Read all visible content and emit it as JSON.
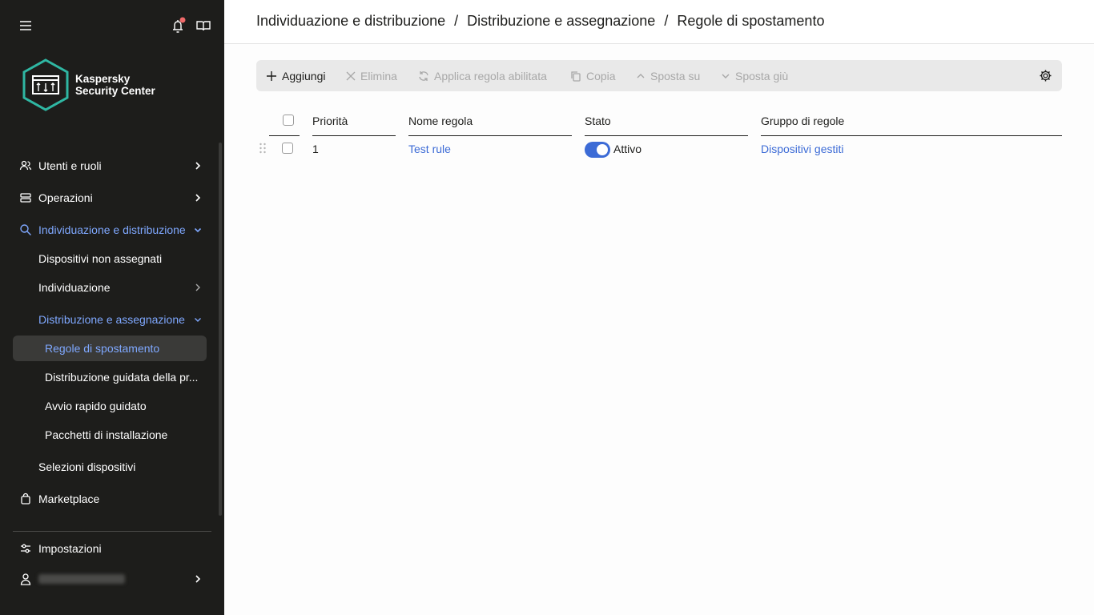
{
  "brand": {
    "line1": "Kaspersky",
    "line2": "Security Center"
  },
  "breadcrumb": [
    "Individuazione e distribuzione",
    "Distribuzione e assegnazione",
    "Regole di spostamento"
  ],
  "breadcrumb_sep": "/",
  "sidebar": {
    "items": [
      {
        "label": "Utenti e ruoli",
        "icon": "users-icon",
        "chevron": "right"
      },
      {
        "label": "Operazioni",
        "icon": "server-icon",
        "chevron": "right"
      },
      {
        "label": "Individuazione e distribuzione",
        "icon": "search-icon",
        "chevron": "down",
        "active": true
      },
      {
        "label": "Dispositivi non assegnati"
      },
      {
        "label": "Individuazione",
        "chevron": "right"
      },
      {
        "label": "Distribuzione e assegnazione",
        "chevron": "down",
        "active": true
      },
      {
        "label": "Regole di spostamento",
        "selected": true
      },
      {
        "label": "Distribuzione guidata della pr..."
      },
      {
        "label": "Avvio rapido guidato"
      },
      {
        "label": "Pacchetti di installazione"
      },
      {
        "label": "Selezioni dispositivi"
      },
      {
        "label": "Marketplace",
        "icon": "bag-icon"
      }
    ],
    "bottom": [
      {
        "label": "Impostazioni",
        "icon": "sliders-icon"
      },
      {
        "label": "",
        "icon": "user-icon",
        "chevron": "right"
      }
    ],
    "accent": "#7fa8ff"
  },
  "toolbar": {
    "add": "Aggiungi",
    "delete": "Elimina",
    "apply": "Applica regola abilitata",
    "copy": "Copia",
    "move_up": "Sposta su",
    "move_down": "Sposta giù"
  },
  "table": {
    "columns": [
      "Priorità",
      "Nome regola",
      "Stato",
      "Gruppo di regole"
    ],
    "rows": [
      {
        "priority": "1",
        "name": "Test rule",
        "state": "Attivo",
        "enabled": true,
        "group": "Dispositivi gestiti"
      }
    ]
  },
  "colors": {
    "link": "#3c6bd6",
    "sidebar_bg": "#1d1d1b",
    "toggle_on": "#3c6bd6",
    "notification_dot": "#f06a6a"
  }
}
